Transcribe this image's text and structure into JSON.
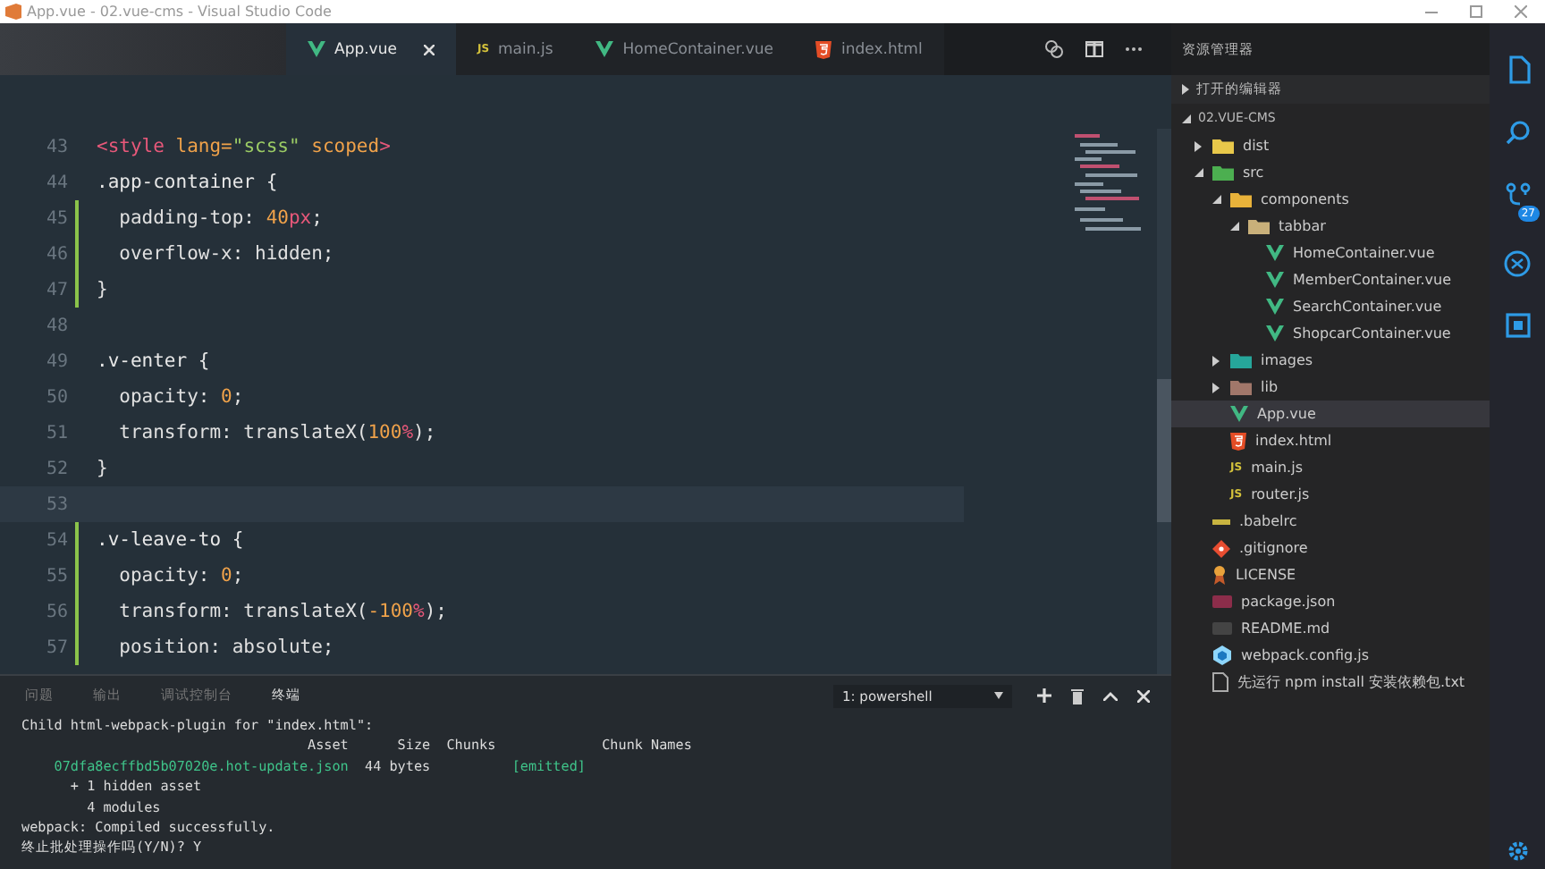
{
  "window": {
    "title": "App.vue - 02.vue-cms - Visual Studio Code"
  },
  "tabs": [
    {
      "label": "App.vue",
      "kind": "vue",
      "selected": true
    },
    {
      "label": "main.js",
      "kind": "js",
      "icon_text": "JS",
      "selected": false
    },
    {
      "label": "HomeContainer.vue",
      "kind": "vue",
      "selected": false
    },
    {
      "label": "index.html",
      "kind": "html",
      "selected": false
    }
  ],
  "editor": {
    "lines": [
      {
        "number": "43",
        "changed": false,
        "tokens": [
          {
            "kind": "tag",
            "text": "<style "
          },
          {
            "kind": "attr",
            "text": "lang="
          },
          {
            "kind": "string",
            "text": "\"scss\" "
          },
          {
            "kind": "attr",
            "text": "scoped"
          },
          {
            "kind": "tag",
            "text": ">"
          }
        ]
      },
      {
        "number": "44",
        "changed": false,
        "tokens": [
          {
            "kind": "selector",
            "text": ".app-container {"
          }
        ]
      },
      {
        "number": "45",
        "changed": true,
        "tokens": [
          {
            "kind": "plain",
            "text": "  padding-top: "
          },
          {
            "kind": "num",
            "text": "40"
          },
          {
            "kind": "unit",
            "text": "px"
          },
          {
            "kind": "plain",
            "text": ";"
          }
        ]
      },
      {
        "number": "46",
        "changed": true,
        "tokens": [
          {
            "kind": "plain",
            "text": "  overflow-x: hidden;"
          }
        ]
      },
      {
        "number": "47",
        "changed": true,
        "tokens": [
          {
            "kind": "plain",
            "text": "}"
          }
        ]
      },
      {
        "number": "48",
        "changed": false
      },
      {
        "number": "49",
        "changed": false,
        "tokens": [
          {
            "kind": "selector",
            "text": ".v-enter {"
          }
        ]
      },
      {
        "number": "50",
        "changed": false,
        "tokens": [
          {
            "kind": "plain",
            "text": "  opacity: "
          },
          {
            "kind": "num",
            "text": "0"
          },
          {
            "kind": "plain",
            "text": ";"
          }
        ]
      },
      {
        "number": "51",
        "changed": false,
        "tokens": [
          {
            "kind": "plain",
            "text": "  transform: translateX("
          },
          {
            "kind": "num",
            "text": "100"
          },
          {
            "kind": "unit",
            "text": "%"
          },
          {
            "kind": "plain",
            "text": ");"
          }
        ]
      },
      {
        "number": "52",
        "changed": false,
        "tokens": [
          {
            "kind": "plain",
            "text": "}"
          }
        ]
      },
      {
        "number": "53",
        "changed": false,
        "current": true
      },
      {
        "number": "54",
        "changed": true,
        "tokens": [
          {
            "kind": "selector",
            "text": ".v-leave-to {"
          }
        ]
      },
      {
        "number": "55",
        "changed": true,
        "tokens": [
          {
            "kind": "plain",
            "text": "  opacity: "
          },
          {
            "kind": "num",
            "text": "0"
          },
          {
            "kind": "plain",
            "text": ";"
          }
        ]
      },
      {
        "number": "56",
        "changed": true,
        "tokens": [
          {
            "kind": "plain",
            "text": "  transform: translateX("
          },
          {
            "kind": "num",
            "text": "-100"
          },
          {
            "kind": "unit",
            "text": "%"
          },
          {
            "kind": "plain",
            "text": ");"
          }
        ]
      },
      {
        "number": "57",
        "changed": true,
        "tokens": [
          {
            "kind": "plain",
            "text": "  position: absolute;"
          }
        ]
      }
    ]
  },
  "panel": {
    "tabs": [
      {
        "label": "问题",
        "selected": false
      },
      {
        "label": "输出",
        "selected": false
      },
      {
        "label": "调试控制台",
        "selected": false
      },
      {
        "label": "终端",
        "selected": true
      }
    ],
    "terminal_select": "1: powershell",
    "terminal": [
      [
        {
          "kind": "plain",
          "text": "Child html-webpack-plugin for \"index.html\":"
        }
      ],
      [
        {
          "kind": "plain",
          "text": "                                   Asset      Size  Chunks             Chunk Names"
        }
      ],
      [
        {
          "kind": "green",
          "text": "    07dfa8ecffbd5b07020e.hot-update.json"
        },
        {
          "kind": "plain",
          "text": "  44 bytes          "
        },
        {
          "kind": "green",
          "text": "[emitted]"
        }
      ],
      [
        {
          "kind": "plain",
          "text": "      + 1 hidden asset"
        }
      ],
      [
        {
          "kind": "plain",
          "text": "        4 modules"
        }
      ],
      [
        {
          "kind": "plain",
          "text": "webpack: Compiled successfully."
        }
      ],
      [
        {
          "kind": "plain",
          "text": "终止批处理操作吗(Y/N)? Y"
        }
      ]
    ]
  },
  "explorer": {
    "title": "资源管理器",
    "open_editors": "打开的编辑器",
    "project": "02.VUE-CMS",
    "tree": [
      {
        "label": "dist",
        "kind": "folder",
        "expanded": false,
        "selected": false
      },
      {
        "label": "src",
        "kind": "folder",
        "expanded": true,
        "selected": false,
        "children": [
          {
            "label": "components",
            "kind": "folder",
            "expanded": true,
            "selected": false,
            "children": [
              {
                "label": "tabbar",
                "kind": "folder",
                "expanded": true,
                "selected": false,
                "children": [
                  {
                    "label": "HomeContainer.vue",
                    "kind": "vue",
                    "selected": false
                  },
                  {
                    "label": "MemberContainer.vue",
                    "kind": "vue",
                    "selected": false
                  },
                  {
                    "label": "SearchContainer.vue",
                    "kind": "vue",
                    "selected": false
                  },
                  {
                    "label": "ShopcarContainer.vue",
                    "kind": "vue",
                    "selected": false
                  }
                ]
              }
            ]
          },
          {
            "label": "images",
            "kind": "folder",
            "expanded": false,
            "selected": false
          },
          {
            "label": "lib",
            "kind": "folder",
            "expanded": false,
            "selected": false
          },
          {
            "label": "App.vue",
            "kind": "vue",
            "selected": true
          },
          {
            "label": "index.html",
            "kind": "html",
            "selected": false
          },
          {
            "label": "main.js",
            "kind": "js",
            "icon_text": "JS",
            "selected": false
          },
          {
            "label": "router.js",
            "kind": "js",
            "icon_text": "JS",
            "selected": false
          }
        ]
      },
      {
        "label": ".babelrc",
        "kind": "babel",
        "selected": false
      },
      {
        "label": ".gitignore",
        "kind": "git",
        "selected": false
      },
      {
        "label": "LICENSE",
        "kind": "license",
        "selected": false
      },
      {
        "label": "package.json",
        "kind": "json",
        "selected": false
      },
      {
        "label": "README.md",
        "kind": "md",
        "selected": false
      },
      {
        "label": "webpack.config.js",
        "kind": "webpack",
        "selected": false
      },
      {
        "label": "先运行 npm install 安装依赖包.txt",
        "kind": "txt",
        "selected": false
      }
    ]
  },
  "activity": {
    "scm_badge": "27"
  }
}
